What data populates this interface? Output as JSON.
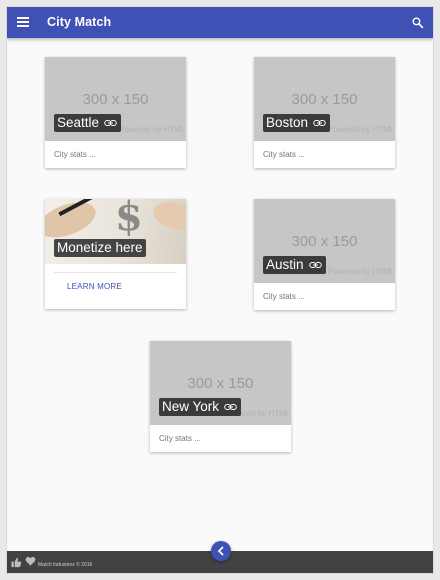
{
  "app": {
    "title": "City Match"
  },
  "placeholder": {
    "size_text": "300 x 150",
    "powered_text": "Powered by HTML.CO"
  },
  "cards": [
    {
      "city": "Seattle",
      "stats": "City stats ..."
    },
    {
      "city": "Boston",
      "stats": "City stats ..."
    },
    {
      "city": "Austin",
      "stats": "City stats ..."
    },
    {
      "city": "New York",
      "stats": "City stats ..."
    }
  ],
  "promo": {
    "label": "Monetize here",
    "action": "LEARN MORE"
  },
  "footer": {
    "copyright": "Match Industries © 2016"
  },
  "colors": {
    "primary": "#3f51b5",
    "footer": "#424242"
  }
}
